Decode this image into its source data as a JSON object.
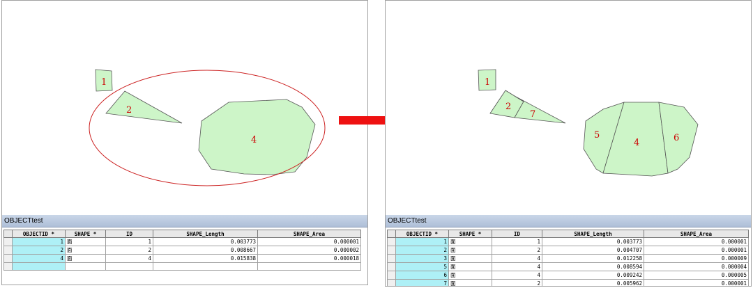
{
  "left": {
    "polygon_labels": [
      "1",
      "2",
      "4"
    ],
    "table": {
      "title": "OBJECTtest",
      "headers": [
        "OBJECTID *",
        "SHAPE *",
        "ID",
        "SHAPE_Length",
        "SHAPE_Area"
      ],
      "rows": [
        {
          "objectid": "1",
          "shape": "面",
          "id": "1",
          "length": "0.003773",
          "area": "0.000001"
        },
        {
          "objectid": "2",
          "shape": "面",
          "id": "2",
          "length": "0.008667",
          "area": "0.000002"
        },
        {
          "objectid": "4",
          "shape": "面",
          "id": "4",
          "length": "0.015838",
          "area": "0.000018"
        }
      ]
    }
  },
  "right": {
    "polygon_labels": [
      "1",
      "2",
      "7",
      "5",
      "4",
      "6"
    ],
    "table": {
      "title": "OBJECTtest",
      "headers": [
        "OBJECTID *",
        "SHAPE *",
        "ID",
        "SHAPE_Length",
        "SHAPE_Area"
      ],
      "rows": [
        {
          "objectid": "1",
          "shape": "面",
          "id": "1",
          "length": "0.003773",
          "area": "0.000001"
        },
        {
          "objectid": "2",
          "shape": "面",
          "id": "2",
          "length": "0.004707",
          "area": "0.000001"
        },
        {
          "objectid": "3",
          "shape": "面",
          "id": "4",
          "length": "0.012258",
          "area": "0.000009"
        },
        {
          "objectid": "5",
          "shape": "面",
          "id": "4",
          "length": "0.008594",
          "area": "0.000004"
        },
        {
          "objectid": "6",
          "shape": "面",
          "id": "4",
          "length": "0.009242",
          "area": "0.000005"
        },
        {
          "objectid": "7",
          "shape": "面",
          "id": "2",
          "length": "0.005962",
          "area": "0.000001"
        }
      ]
    }
  },
  "colors": {
    "polygon_fill": "#cdf5c8",
    "polygon_stroke": "#555555",
    "label": "#cc0000",
    "selection_ellipse": "#cc2222",
    "arrow": "#ee1111",
    "objectid_cell": "#aef0f6"
  }
}
